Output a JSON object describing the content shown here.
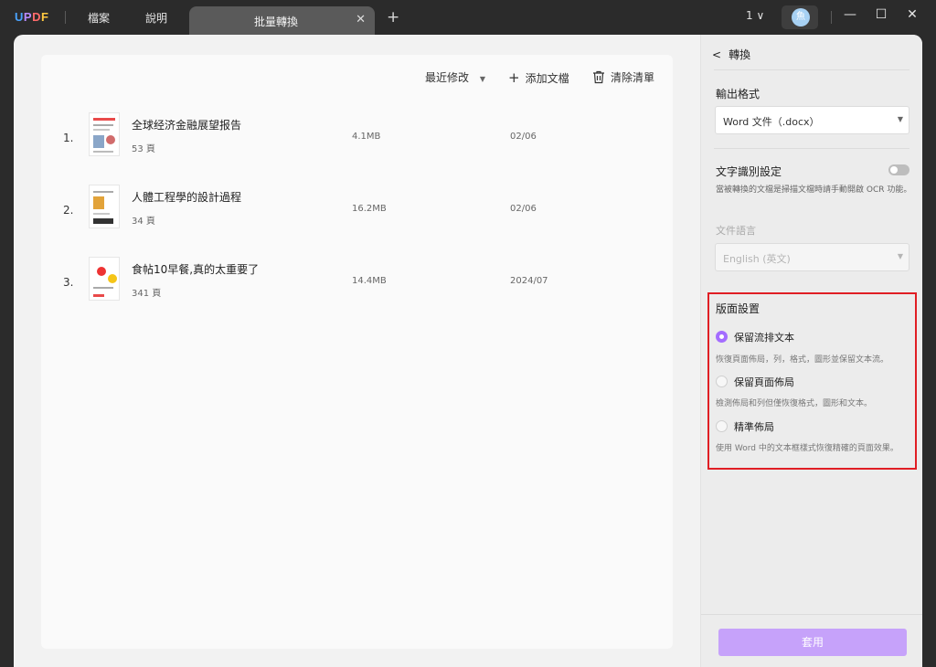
{
  "app": {
    "logo_letters": [
      "U",
      "P",
      "D",
      "F"
    ]
  },
  "menu": {
    "file": "檔案",
    "help": "說明"
  },
  "tab": {
    "title": "批量轉換",
    "close": "✕",
    "add": "+"
  },
  "titlebar": {
    "page_count": "1",
    "page_count_chevron": "∨",
    "avatar_initial": "魚",
    "minimize": "—",
    "maximize": "☐",
    "close": "✕"
  },
  "list": {
    "toolbar": {
      "sort_label": "最近修改",
      "sort_arrow": "▼",
      "add_icon": "+",
      "add_label": "添加文檔",
      "clear_label": "清除清單"
    },
    "files": [
      {
        "index": "1.",
        "name": "全球经济金融展望报告",
        "pages": "53 頁",
        "size": "4.1MB",
        "date": "02/06"
      },
      {
        "index": "2.",
        "name": "人體工程學的設計過程",
        "pages": "34 頁",
        "size": "16.2MB",
        "date": "02/06"
      },
      {
        "index": "3.",
        "name": "食帖10早餐,真的太重要了",
        "pages": "341 頁",
        "size": "14.4MB",
        "date": "2024/07"
      }
    ]
  },
  "settings": {
    "back_label": "轉換",
    "back_icon": "<",
    "output_format_title": "輸出格式",
    "output_format_value": "Word 文件（.docx）",
    "ocr_title": "文字識別設定",
    "ocr_hint": "當被轉換的文檔是掃描文檔時請手動開啟 OCR 功能。",
    "ocr_enabled": false,
    "doc_language_label": "文件語言",
    "doc_language_value": "English (英文)",
    "layout_title": "版面設置",
    "layout_options": [
      {
        "label": "保留流排文本",
        "desc": "恢復頁面佈局，列，格式，圖形並保留文本流。",
        "selected": true
      },
      {
        "label": "保留頁面佈局",
        "desc": "檢測佈局和列但僅恢復格式，圖形和文本。",
        "selected": false
      },
      {
        "label": "精準佈局",
        "desc": "使用 Word 中的文本框樣式恢復精確的頁面效果。",
        "selected": false
      }
    ],
    "apply_label": "套用",
    "dropdown_arrow": "▼"
  },
  "colors": {
    "accent": "#a46dff",
    "apply_button": "#c6a2fa",
    "highlight_box": "#e01e24"
  }
}
